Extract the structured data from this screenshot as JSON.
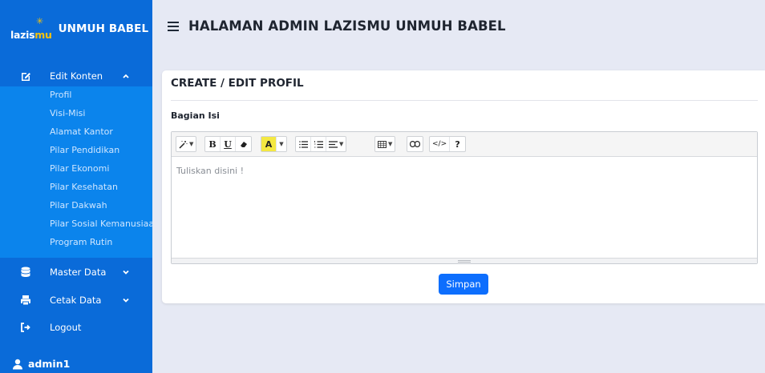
{
  "brand": {
    "logo_text_a": "lazis",
    "logo_text_b": "mu",
    "name": "UNMUH BABEL"
  },
  "header": {
    "title": "HALAMAN ADMIN LAZISMU UNMUH BABEL"
  },
  "sidebar": {
    "edit_konten": "Edit Konten",
    "submenu": [
      "Profil",
      "Visi-Misi",
      "Alamat Kantor",
      "Pilar Pendidikan",
      "Pilar Ekonomi",
      "Pilar Kesehatan",
      "Pilar Dakwah",
      "Pilar Sosial Kemanusiaan",
      "Program Rutin"
    ],
    "master_data": "Master Data",
    "cetak_data": "Cetak Data",
    "logout": "Logout",
    "user": "admin1"
  },
  "card": {
    "title": "CREATE / EDIT PROFIL",
    "section_label": "Bagian Isi"
  },
  "editor": {
    "placeholder": "Tuliskan disini !",
    "toolbar": {
      "bold": "B",
      "underline": "U",
      "color": "A",
      "help": "?",
      "code": "</>"
    }
  },
  "actions": {
    "save": "Simpan"
  },
  "colors": {
    "sidebar": "#0a6bd9",
    "submenu": "#0b84ec",
    "primary_button": "#0d6efd",
    "background": "#e6e9f4",
    "highlight": "#f4e842"
  }
}
